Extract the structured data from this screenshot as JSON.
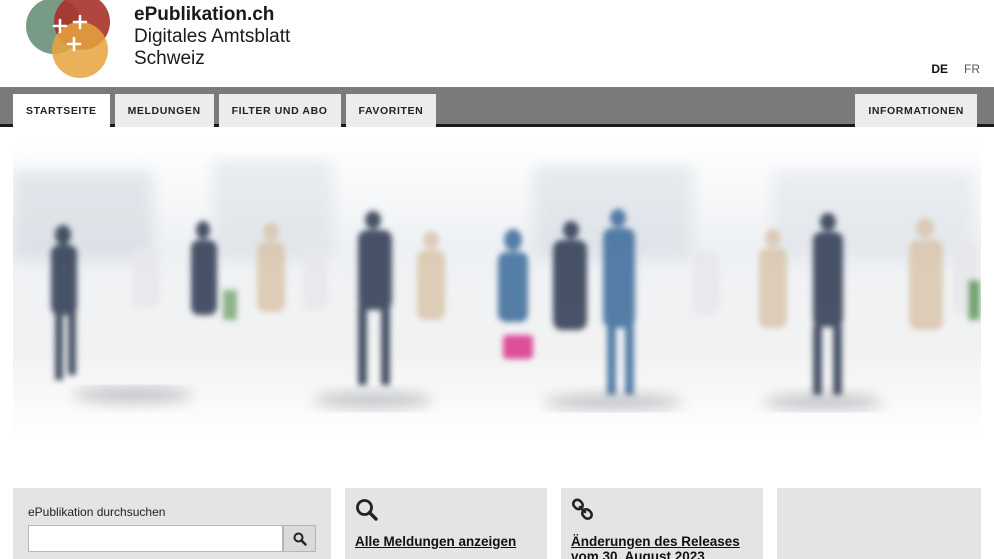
{
  "header": {
    "brand_name": "ePublikation.ch",
    "brand_line1": "Digitales Amtsblatt",
    "brand_line2": "Schweiz",
    "logo_icon": "epublikation-logo-icon",
    "languages": [
      {
        "code": "DE",
        "active": true
      },
      {
        "code": "FR",
        "active": false
      }
    ]
  },
  "nav": {
    "tabs": [
      {
        "label": "STARTSEITE",
        "active": true
      },
      {
        "label": "MELDUNGEN",
        "active": false
      },
      {
        "label": "FILTER UND ABO",
        "active": false
      },
      {
        "label": "FAVORITEN",
        "active": false
      }
    ],
    "right_tab": {
      "label": "INFORMATIONEN"
    }
  },
  "hero": {
    "image": "crowd-walking-photo"
  },
  "tiles": {
    "search": {
      "label": "ePublikation durchsuchen",
      "value": "",
      "placeholder": "",
      "button_icon": "search-icon"
    },
    "all_messages": {
      "icon": "search-icon",
      "link": "Alle Meldungen anzeigen"
    },
    "release": {
      "icon": "link-icon",
      "link": "Änderungen des Releases vom 30. August 2023"
    },
    "empty": {}
  },
  "colors": {
    "nav_bg": "#7a7a7a",
    "nav_border": "#1a1a1a",
    "tab_bg": "#ececec",
    "tile_bg": "#e4e4e4",
    "logo_green": "#5f8a6e",
    "logo_red": "#a8322a",
    "logo_orange": "#e8a33d"
  }
}
